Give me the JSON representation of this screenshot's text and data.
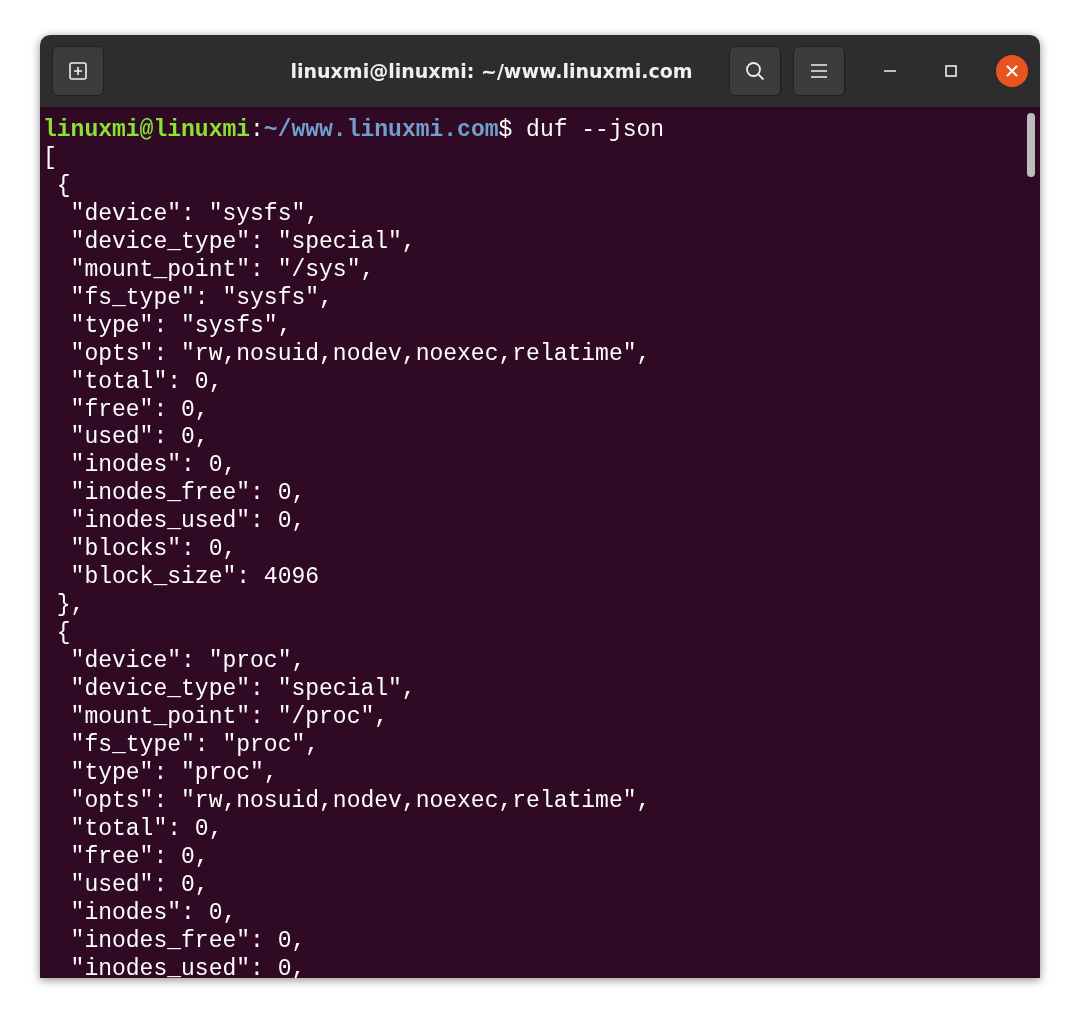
{
  "window": {
    "title": "linuxmi@linuxmi: ~/www.linuxmi.com"
  },
  "terminal": {
    "prompt": {
      "user_host": "linuxmi@linuxmi",
      "separator": ":",
      "path": "~/www.linuxmi.com",
      "symbol": "$",
      "command": "duf --json"
    },
    "output": [
      "[",
      " {",
      "  \"device\": \"sysfs\",",
      "  \"device_type\": \"special\",",
      "  \"mount_point\": \"/sys\",",
      "  \"fs_type\": \"sysfs\",",
      "  \"type\": \"sysfs\",",
      "  \"opts\": \"rw,nosuid,nodev,noexec,relatime\",",
      "  \"total\": 0,",
      "  \"free\": 0,",
      "  \"used\": 0,",
      "  \"inodes\": 0,",
      "  \"inodes_free\": 0,",
      "  \"inodes_used\": 0,",
      "  \"blocks\": 0,",
      "  \"block_size\": 4096",
      " },",
      " {",
      "  \"device\": \"proc\",",
      "  \"device_type\": \"special\",",
      "  \"mount_point\": \"/proc\",",
      "  \"fs_type\": \"proc\",",
      "  \"type\": \"proc\",",
      "  \"opts\": \"rw,nosuid,nodev,noexec,relatime\",",
      "  \"total\": 0,",
      "  \"free\": 0,",
      "  \"used\": 0,",
      "  \"inodes\": 0,",
      "  \"inodes_free\": 0,",
      "  \"inodes_used\": 0,"
    ]
  }
}
